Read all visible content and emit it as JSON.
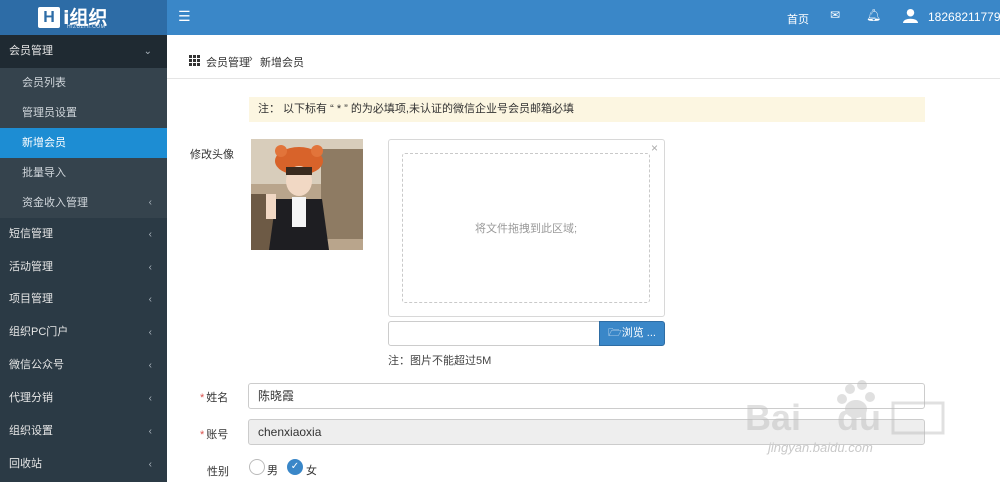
{
  "app": {
    "logo_mark": "H",
    "logo_text": "i组织",
    "logo_sub": "HIZUZHI.COM"
  },
  "topbar": {
    "menu_icon": "hamburger-icon",
    "home_label": "首页",
    "mail_icon": "envelope-icon",
    "bell_icon": "bell-icon",
    "user_icon": "user-icon",
    "username": "18268211779"
  },
  "sidebar": {
    "open_group": "会员管理",
    "sub_items": [
      {
        "label": "会员列表"
      },
      {
        "label": "管理员设置"
      },
      {
        "label": "新增会员"
      },
      {
        "label": "批量导入"
      },
      {
        "label": "资金收入管理"
      }
    ],
    "groups": [
      {
        "label": "短信管理"
      },
      {
        "label": "活动管理"
      },
      {
        "label": "项目管理"
      },
      {
        "label": "组织PC门户"
      },
      {
        "label": "微信公众号"
      },
      {
        "label": "代理分销"
      },
      {
        "label": "组织设置"
      },
      {
        "label": "回收站"
      }
    ],
    "active_item": "新增会员"
  },
  "breadcrumb": {
    "icon": "grid-icon",
    "items": [
      "会员管理",
      "新增会员"
    ],
    "separator": "›"
  },
  "form": {
    "notice": "注： 以下标有 “ * ” 的为必填项,未认证的微信企业号会员邮箱必填",
    "avatar_label": "修改头像",
    "drop_text": "将文件拖拽到此区域;",
    "close_icon": "×",
    "browse_label": "浏览 ...",
    "upload_note": "注：图片不能超过5M",
    "name_label": "姓名",
    "name_value": "陈晓霞",
    "account_label": "账号",
    "account_value": "chenxiaoxia",
    "gender_label": "性别",
    "gender_options": [
      "男",
      "女"
    ],
    "gender_selected": "女"
  },
  "watermark": {
    "text": "jingyan.baidu.com"
  },
  "colors": {
    "topbar": "#3a87c8",
    "sidebar": "#2b3a45",
    "active": "#1d8dd3",
    "notice_bg": "#fcf6e1",
    "required": "#d9534f"
  }
}
